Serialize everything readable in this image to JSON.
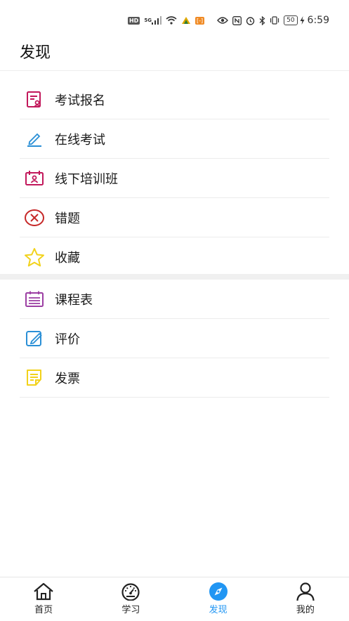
{
  "status_bar": {
    "hd": "HD",
    "network": "5G",
    "battery": "50",
    "time": "6:59"
  },
  "page": {
    "title": "发现"
  },
  "menu_top": [
    {
      "label": "考试报名",
      "icon": "exam-registration-icon",
      "color": "#c2185b"
    },
    {
      "label": "在线考试",
      "icon": "pen-icon",
      "color": "#2a8fd6"
    },
    {
      "label": "线下培训班",
      "icon": "training-class-icon",
      "color": "#c2185b"
    },
    {
      "label": "错题",
      "icon": "wrong-answer-icon",
      "color": "#c62828"
    },
    {
      "label": "收藏",
      "icon": "star-icon",
      "color": "#f2d21b"
    }
  ],
  "menu_bottom": [
    {
      "label": "课程表",
      "icon": "schedule-icon",
      "color": "#9c3fa3"
    },
    {
      "label": "评价",
      "icon": "review-icon",
      "color": "#2a8fd6"
    },
    {
      "label": "发票",
      "icon": "invoice-icon",
      "color": "#f2d21b"
    }
  ],
  "tabbar": {
    "items": [
      {
        "label": "首页",
        "icon": "home-icon",
        "active": false
      },
      {
        "label": "学习",
        "icon": "speedometer-icon",
        "active": false
      },
      {
        "label": "发现",
        "icon": "compass-icon",
        "active": true
      },
      {
        "label": "我的",
        "icon": "user-icon",
        "active": false
      }
    ],
    "active_color": "#2196f3"
  }
}
